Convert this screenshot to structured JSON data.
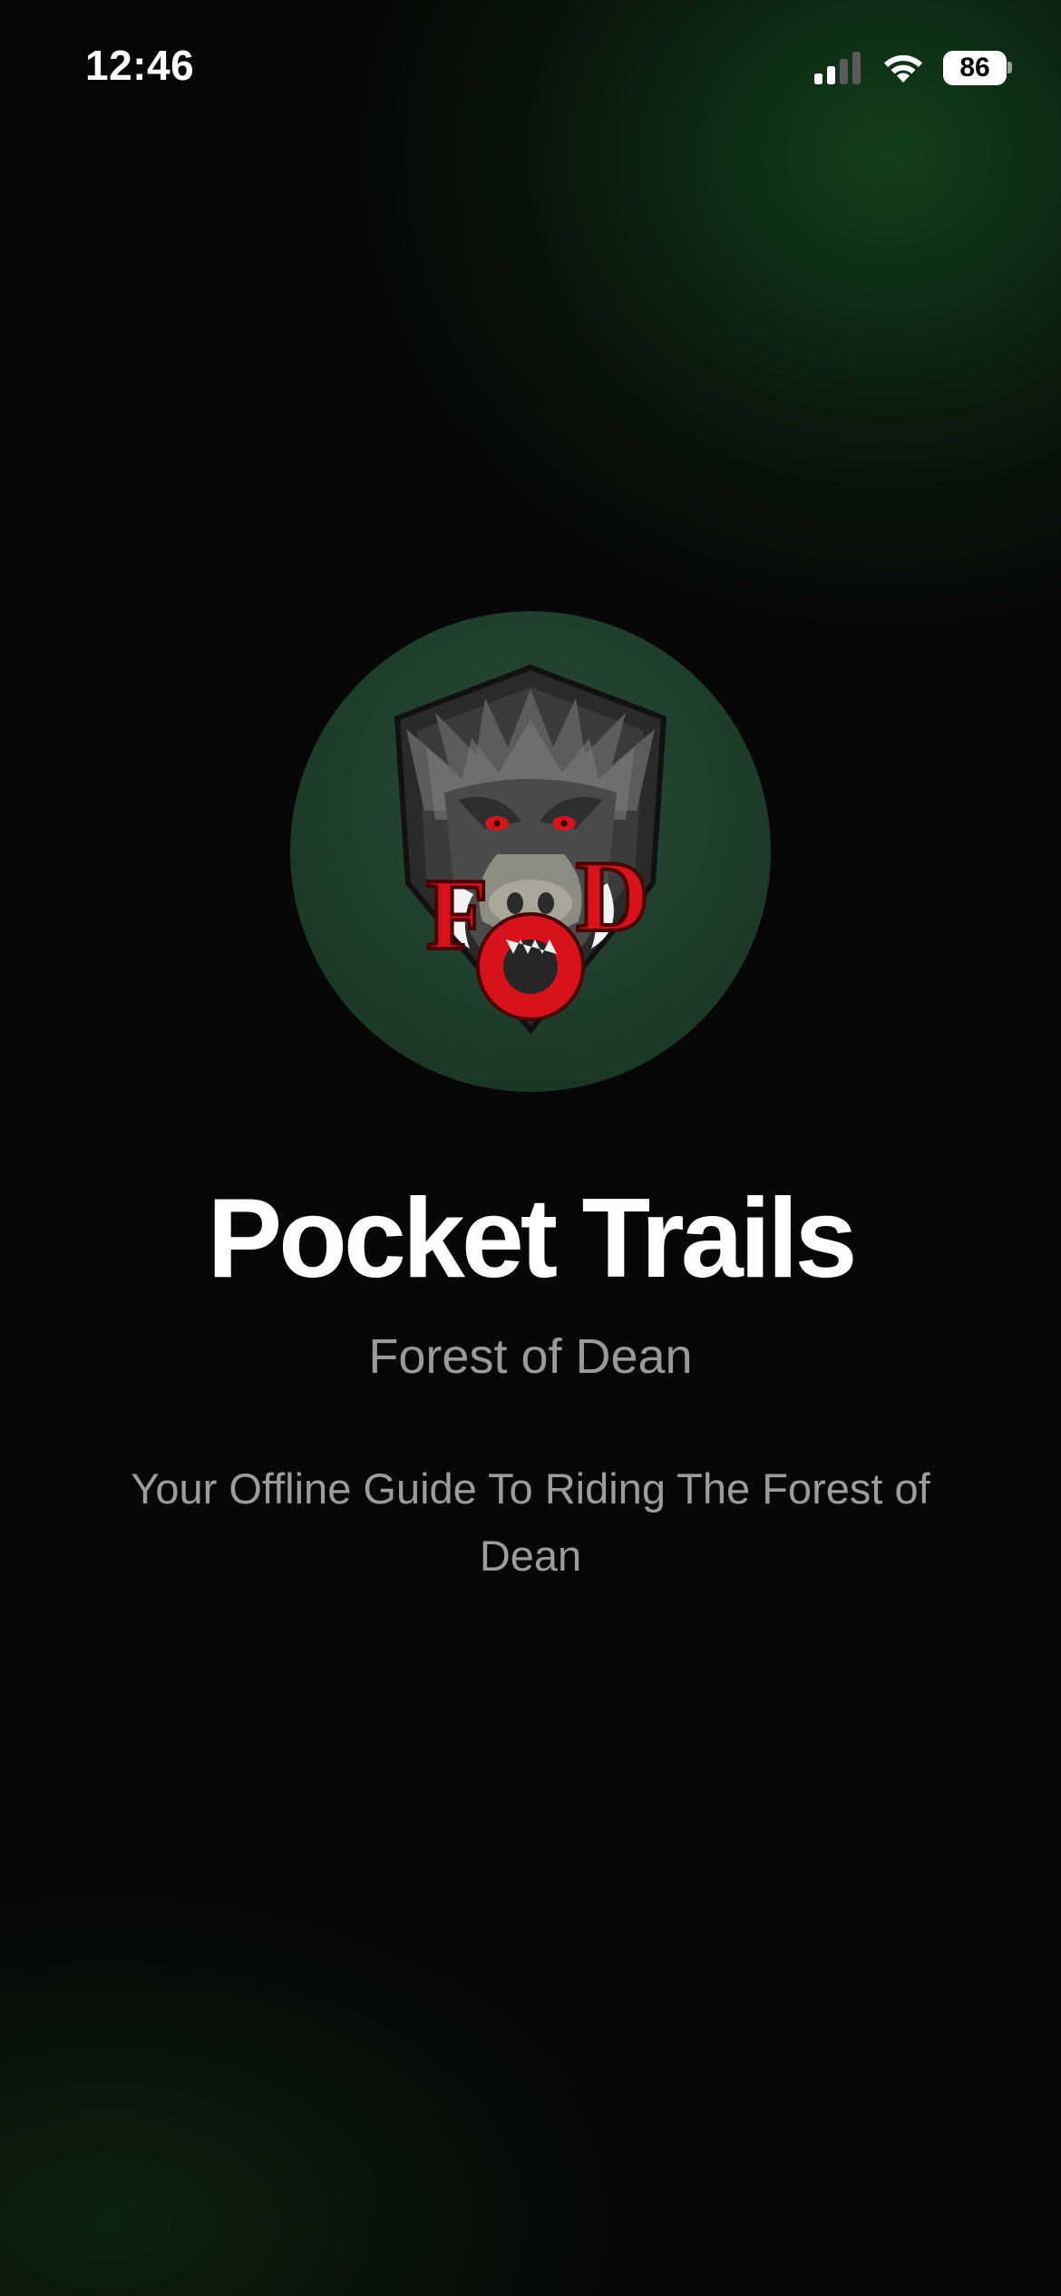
{
  "status_bar": {
    "time": "12:46",
    "battery_level": "86",
    "signal_bars_active": 2,
    "signal_bars_total": 4,
    "icons": [
      "signal-icon",
      "wifi-icon",
      "battery-icon"
    ]
  },
  "logo": {
    "icon": "boar-crest-logo",
    "letters": "FOD",
    "circle_color": "#1f3d2b",
    "accent_color": "#d8121b"
  },
  "header": {
    "title": "Pocket Trails",
    "subtitle": "Forest of Dean",
    "tagline": "Your Offline Guide To Riding The Forest of Dean"
  },
  "theme": {
    "background": "#060606",
    "glow": "#1e6e2d",
    "title_color": "#ffffff",
    "secondary_text": "#9a9a9a"
  }
}
